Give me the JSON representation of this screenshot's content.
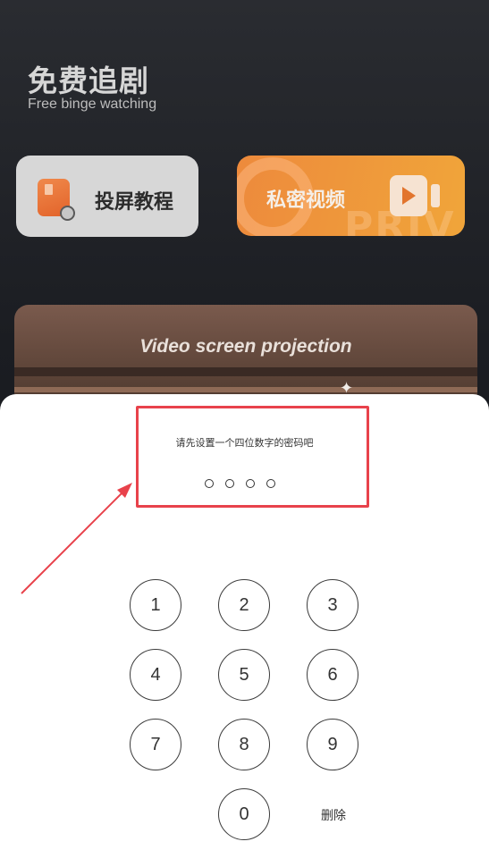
{
  "header": {
    "title": "免费追剧",
    "subtitle": "Free binge watching"
  },
  "cards": {
    "cast_label": "投屏教程",
    "private_label": "私密视频",
    "private_watermark": "PRIV"
  },
  "banner": {
    "text": "Video screen projection"
  },
  "passcode": {
    "prompt": "请先设置一个四位数字的密码吧",
    "digits": 4,
    "keys": [
      "1",
      "2",
      "3",
      "4",
      "5",
      "6",
      "7",
      "8",
      "9",
      "0"
    ],
    "delete_label": "删除"
  },
  "annotation": {
    "color": "#e8424b"
  },
  "colors": {
    "accent_orange": "#ed8a3c",
    "background": "#15171c",
    "sheet": "#ffffff"
  }
}
